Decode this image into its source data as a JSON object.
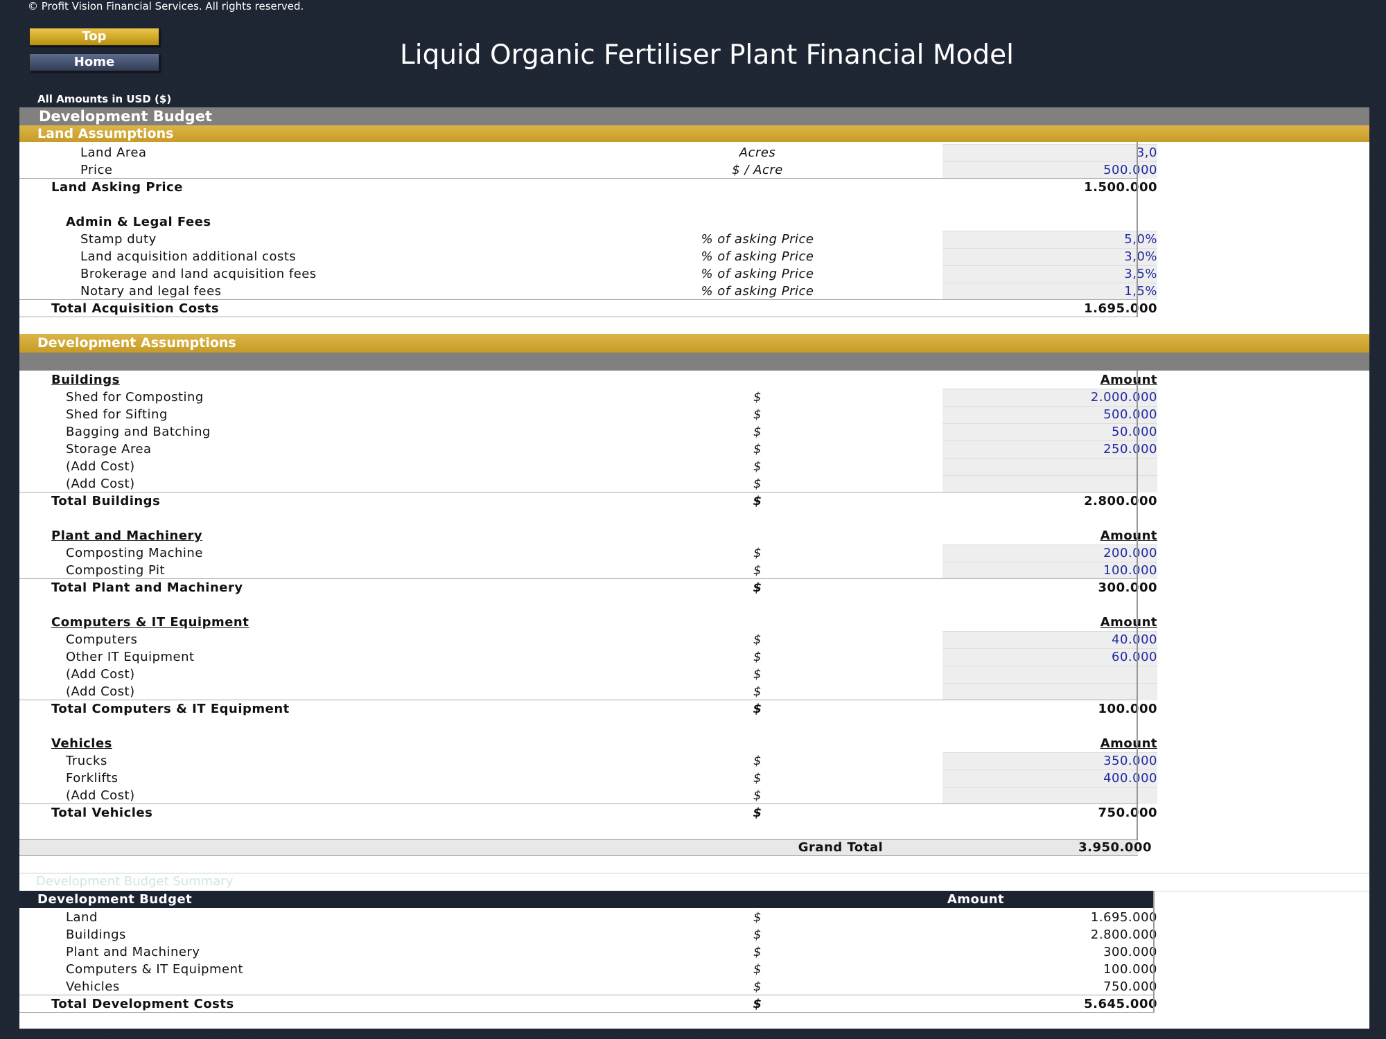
{
  "copyright": "© Profit Vision Financial Services. All rights reserved.",
  "nav": {
    "top": "Top",
    "home": "Home"
  },
  "title": "Liquid Organic Fertiliser Plant Financial Model",
  "currency": "All Amounts in  USD ($)",
  "development_budget_title": "Development Budget",
  "land": {
    "section": "Land Assumptions",
    "area": {
      "label": "Land Area",
      "unit": "Acres",
      "value": "3,0"
    },
    "price": {
      "label": "Price",
      "unit": "$ / Acre",
      "value": "500.000"
    },
    "asking_price": {
      "label": "Land Asking Price",
      "value": "1.500.000"
    },
    "fees_header": "Admin & Legal Fees",
    "fees": [
      {
        "label": "Stamp duty",
        "unit": "% of asking Price",
        "value": "5,0%"
      },
      {
        "label": "Land acquisition additional costs",
        "unit": "% of asking Price",
        "value": "3,0%"
      },
      {
        "label": "Brokerage and land acquisition fees",
        "unit": "% of asking Price",
        "value": "3,5%"
      },
      {
        "label": "Notary and legal fees",
        "unit": "% of asking Price",
        "value": "1,5%"
      }
    ],
    "total": {
      "label": "Total Acquisition Costs",
      "value": "1.695.000"
    }
  },
  "development": {
    "section": "Development Assumptions",
    "amount_header": "Amount",
    "currency_symbol": "$",
    "buildings": {
      "header": "Buildings",
      "items": [
        {
          "label": "Shed for Composting",
          "value": "2.000.000"
        },
        {
          "label": "Shed for Sifting",
          "value": "500.000"
        },
        {
          "label": "Bagging and Batching",
          "value": "50.000"
        },
        {
          "label": "Storage Area",
          "value": "250.000"
        },
        {
          "label": "(Add Cost)",
          "value": ""
        },
        {
          "label": "(Add Cost)",
          "value": ""
        }
      ],
      "total": {
        "label": "Total Buildings",
        "value": "2.800.000"
      }
    },
    "plant": {
      "header": "Plant and Machinery",
      "items": [
        {
          "label": "Composting Machine",
          "value": "200.000"
        },
        {
          "label": "Composting Pit",
          "value": "100.000"
        }
      ],
      "total": {
        "label": "Total Plant and Machinery",
        "value": "300.000"
      }
    },
    "it": {
      "header": "Computers & IT Equipment",
      "items": [
        {
          "label": "Computers",
          "value": "40.000"
        },
        {
          "label": "Other IT Equipment",
          "value": "60.000"
        },
        {
          "label": "(Add Cost)",
          "value": ""
        },
        {
          "label": "(Add Cost)",
          "value": ""
        }
      ],
      "total": {
        "label": "Total Computers & IT Equipment",
        "value": "100.000"
      }
    },
    "vehicles": {
      "header": "Vehicles",
      "items": [
        {
          "label": "Trucks",
          "value": "350.000"
        },
        {
          "label": "Forklifts",
          "value": "400.000"
        },
        {
          "label": "(Add Cost)",
          "value": ""
        }
      ],
      "total": {
        "label": "Total Vehicles",
        "value": "750.000"
      }
    },
    "grand_total": {
      "label": "Grand Total",
      "value": "3.950.000"
    }
  },
  "summary": {
    "faint_title": "Development Budget Summary",
    "header_label": "Development Budget",
    "header_amount": "Amount",
    "items": [
      {
        "label": "Land",
        "value": "1.695.000"
      },
      {
        "label": "Buildings",
        "value": "2.800.000"
      },
      {
        "label": "Plant and Machinery",
        "value": "300.000"
      },
      {
        "label": "Computers & IT Equipment",
        "value": "100.000"
      },
      {
        "label": "Vehicles",
        "value": "750.000"
      }
    ],
    "total": {
      "label": "Total Development Costs",
      "value": "5.645.000"
    }
  }
}
